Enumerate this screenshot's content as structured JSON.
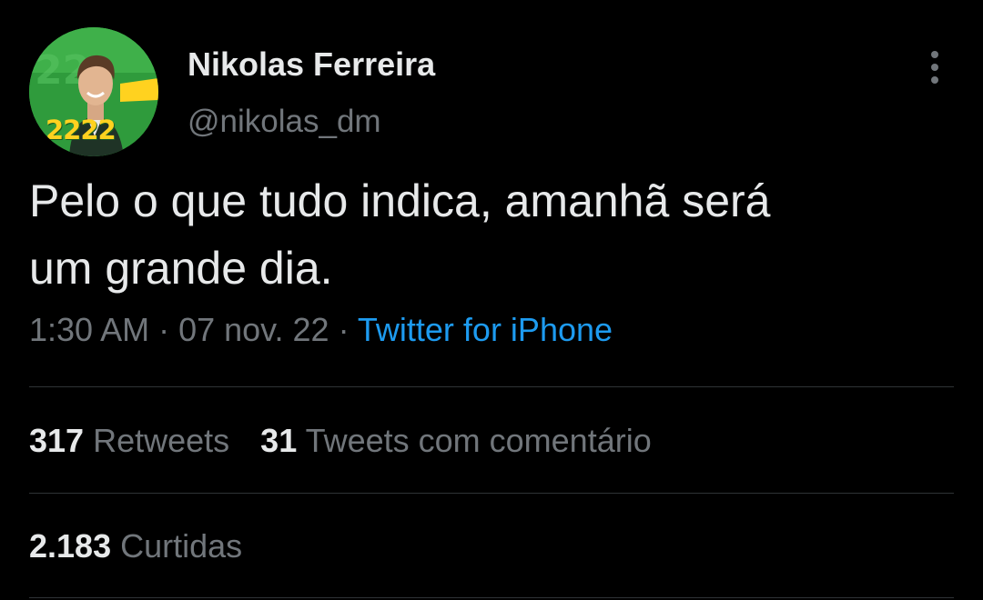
{
  "author": {
    "display_name": "Nikolas Ferreira",
    "handle": "@nikolas_dm",
    "avatar_number": "2222"
  },
  "tweet": {
    "text_line1": "Pelo o que tudo indica, amanhã será",
    "text_line2": "um grande dia.",
    "time": "1:30 AM",
    "sep1": " · ",
    "date": "07 nov. 22",
    "sep2": " · ",
    "source": "Twitter for iPhone"
  },
  "stats": {
    "retweets_count": "317",
    "retweets_label": "Retweets",
    "quotes_count": "31",
    "quotes_label": "Tweets com comentário",
    "likes_count": "2.183",
    "likes_label": "Curtidas"
  },
  "icons": {
    "more": "more-vertical-icon"
  },
  "colors": {
    "background": "#000000",
    "text": "#e7e9ea",
    "secondary": "#71767b",
    "link": "#1d9bf0",
    "divider": "#2f3336"
  }
}
